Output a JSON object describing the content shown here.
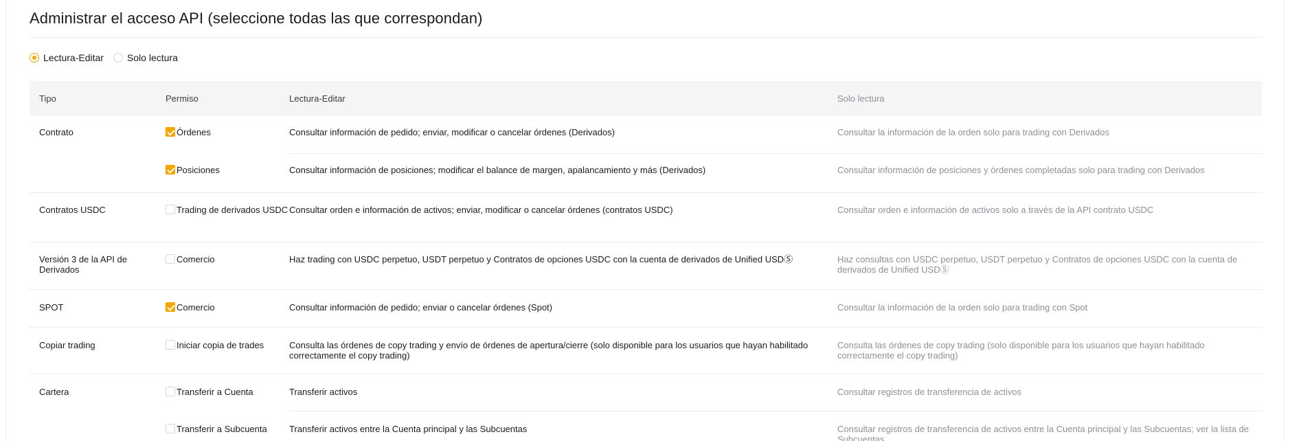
{
  "title": "Administrar el acceso API (seleccione todas las que correspondan)",
  "access_mode": {
    "options": [
      {
        "label": "Lectura-Editar",
        "selected": true
      },
      {
        "label": "Solo lectura",
        "selected": false
      }
    ]
  },
  "table": {
    "headers": {
      "type": "Tipo",
      "permission": "Permiso",
      "read_edit": "Lectura-Editar",
      "read_only": "Solo lectura"
    },
    "rows": [
      {
        "type": "Contrato",
        "permission": "Órdenes",
        "checked": true,
        "read_edit": "Consultar información de pedido; enviar, modificar o cancelar órdenes (Derivados)",
        "read_only": "Consultar la información de la orden solo para trading con Derivados"
      },
      {
        "type": "",
        "permission": "Posiciones",
        "checked": true,
        "read_edit": "Consultar información de posiciones; modificar el balance de margen, apalancamiento y más (Derivados)",
        "read_only": "Consultar información de posiciones y órdenes completadas solo para trading con Derivados"
      },
      {
        "type": "Contratos USDC",
        "permission": "Trading de derivados USDC",
        "checked": false,
        "read_edit": "Consultar orden e información de activos; enviar, modificar o cancelar órdenes (contratos USDC)",
        "read_only": "Consultar orden e información de activos solo a través de la API contrato USDC"
      },
      {
        "type": "Versión 3 de la API de Derivados",
        "permission": "Comercio",
        "checked": false,
        "read_edit": "Haz trading con USDC perpetuo, USDT perpetuo y Contratos de opciones USDC con la cuenta de derivados de Unified USDⓈ",
        "read_only": "Haz consultas con USDC perpetuo, USDT perpetuo y Contratos de opciones USDC con la cuenta de derivados de Unified USDⓈ"
      },
      {
        "type": "SPOT",
        "permission": "Comercio",
        "checked": true,
        "read_edit": "Consultar información de pedido; enviar o cancelar órdenes (Spot)",
        "read_only": "Consultar la información de la orden solo para trading con Spot"
      },
      {
        "type": "Copiar trading",
        "permission": "Iniciar copia de trades",
        "checked": false,
        "read_edit": "Consulta las órdenes de copy trading y envío de órdenes de apertura/cierre (solo disponible para los usuarios que hayan habilitado correctamente el copy trading)",
        "read_only": "Consulta las órdenes de copy trading (solo disponible para los usuarios que hayan habilitado correctamente el copy trading)"
      },
      {
        "type": "Cartera",
        "permission": "Transferir a Cuenta",
        "checked": false,
        "read_edit": "Transferir activos",
        "read_only": "Consultar registros de transferencia de activos"
      },
      {
        "type": "",
        "permission": "Transferir a Subcuenta",
        "checked": false,
        "read_edit": "Transferir activos entre la Cuenta principal y las Subcuentas",
        "read_only": "Consultar registros de transferencia de activos entre la Cuenta principal y las Subcuentas; ver la lista de Subcuentas"
      }
    ]
  },
  "colors": {
    "accent": "#f7a600",
    "muted_text": "#8f8f99",
    "header_bg": "#f5f5f6"
  }
}
